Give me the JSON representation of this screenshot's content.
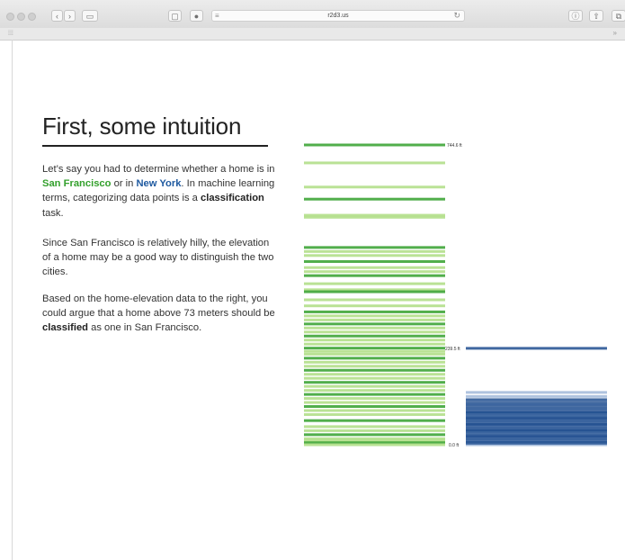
{
  "browser": {
    "url": "r2d3.us"
  },
  "article": {
    "title": "First, some intuition",
    "p1": {
      "t1": "Let’s say you had to determine whether a home is in ",
      "sf": "San Francisco",
      "t2": " or in ",
      "ny": "New York",
      "t3": ". In machine learning terms, categorizing data points is a ",
      "b": "classification",
      "t4": " task."
    },
    "p2": "Since San Francisco is relatively hilly, the elevation of a home may be a good way to distinguish the two cities.",
    "p3": {
      "t1": "Based on the home-elevation data to the right, you could argue that a home above 73 meters should be ",
      "b": "classified",
      "t2": " as one in San Francisco."
    }
  },
  "colors": {
    "sf": "#33a02c",
    "sf_light": "#b2df8a",
    "ny": "#1f4e8f",
    "ny_light": "#a6bddb"
  },
  "chart_data": {
    "type": "strip",
    "unit": "ft",
    "tick_labels": [
      "744.6 ft",
      "239.5 ft",
      "0.0 ft"
    ],
    "y_range": [
      0,
      744.6
    ],
    "series": [
      {
        "name": "San Francisco",
        "color": "#33a02c",
        "elevations": [
          744.6,
          700,
          640,
          610,
          570,
          565,
          490,
          480,
          470,
          455,
          440,
          430,
          420,
          400,
          385,
          380,
          360,
          345,
          330,
          320,
          310,
          300,
          290,
          280,
          270,
          260,
          250,
          240,
          232,
          225,
          215,
          205,
          195,
          185,
          175,
          165,
          155,
          145,
          135,
          125,
          115,
          105,
          95,
          85,
          75,
          60,
          45,
          35,
          25,
          15,
          10,
          5,
          0
        ]
      },
      {
        "name": "New York",
        "color": "#1f4e8f",
        "elevations": [
          239.5,
          130,
          120,
          112,
          100,
          90,
          80,
          75,
          70,
          65,
          60,
          55,
          50,
          45,
          40,
          35,
          30,
          25,
          20,
          15,
          10,
          5,
          2,
          0
        ]
      }
    ]
  }
}
